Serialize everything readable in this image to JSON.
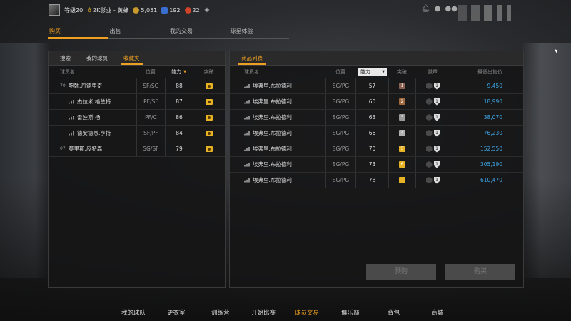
{
  "topbar": {
    "level": "等级20",
    "career": "2K影业 - 黄蜂",
    "vc": "5,051",
    "mt": "192",
    "tokens": "22",
    "plus": "+"
  },
  "main_tabs": [
    "购买",
    "出售",
    "我的交易",
    "球星体验"
  ],
  "left_panel": {
    "tabs": [
      "搜索",
      "我的球员",
      "收藏夹"
    ],
    "columns": [
      "球员名",
      "位置",
      "能力",
      "突破"
    ],
    "sort_arrow": "▼",
    "rows": [
      {
        "num": "70",
        "name": "鲍勃.丹德里奇",
        "pos": "SF/SG",
        "ovr": "88"
      },
      {
        "num": "",
        "name": "杰拉米.格兰特",
        "pos": "PF/SF",
        "ovr": "87"
      },
      {
        "num": "",
        "name": "雷迪斯.杨",
        "pos": "PF/C",
        "ovr": "86"
      },
      {
        "num": "",
        "name": "德安德烈.亨特",
        "pos": "SF/PF",
        "ovr": "84"
      },
      {
        "num": "07",
        "name": "莫里斯.皮特森",
        "pos": "SG/SF",
        "ovr": "79"
      }
    ]
  },
  "right_panel": {
    "tab": "商品列表",
    "columns": [
      "球员名",
      "位置",
      "能力",
      "突破",
      "徽章",
      "最低出售价"
    ],
    "sort_label": "能力",
    "rows": [
      {
        "name": "埃弗里.布拉德利",
        "pos": "SG/PG",
        "ovr": "57",
        "rank": "1",
        "rank_color": "#8a6050",
        "badges": "1",
        "price": "9,450"
      },
      {
        "name": "埃弗里.布拉德利",
        "pos": "SG/PG",
        "ovr": "60",
        "rank": "2",
        "rank_color": "#a06a40",
        "badges": "1",
        "price": "18,990"
      },
      {
        "name": "埃弗里.布拉德利",
        "pos": "SG/PG",
        "ovr": "63",
        "rank": "3",
        "rank_color": "#9a9a9a",
        "badges": "1",
        "price": "38,070"
      },
      {
        "name": "埃弗里.布拉德利",
        "pos": "SG/PG",
        "ovr": "66",
        "rank": "4",
        "rank_color": "#b0b0b0",
        "badges": "1",
        "price": "76,230"
      },
      {
        "name": "埃弗里.布拉德利",
        "pos": "SG/PG",
        "ovr": "70",
        "rank": "5",
        "rank_color": "#e5b325",
        "badges": "1",
        "price": "152,550"
      },
      {
        "name": "埃弗里.布拉德利",
        "pos": "SG/PG",
        "ovr": "73",
        "rank": "6",
        "rank_color": "#e5b325",
        "badges": "1",
        "price": "305,190"
      },
      {
        "name": "埃弗里.布拉德利",
        "pos": "SG/PG",
        "ovr": "78",
        "rank": "",
        "rank_color": "#e5b325",
        "badges": "1",
        "price": "610,470"
      }
    ],
    "btn_bid": "预购",
    "btn_buy": "购买"
  },
  "bottom_nav": [
    "我的球队",
    "更衣室",
    "训练营",
    "开始比赛",
    "球员交易",
    "俱乐部",
    "背包",
    "商城"
  ],
  "bottom_active": "球员交易",
  "colors": {
    "accent": "#f0a020",
    "price": "#3da6e6"
  }
}
